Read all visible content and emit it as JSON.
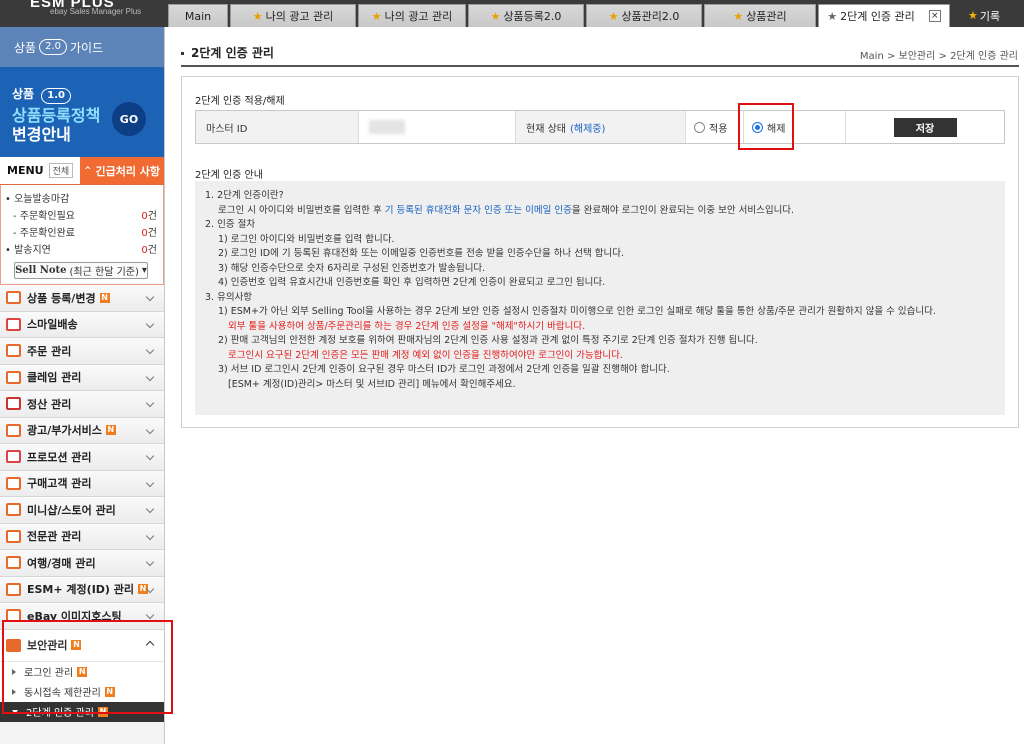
{
  "logo": {
    "text": "ESM PLUS",
    "sub": "ebay Sales Manager Plus"
  },
  "tabs": [
    {
      "label": "Main",
      "starred": false
    },
    {
      "label": "나의 광고 관리",
      "starred": true
    },
    {
      "label": "나의 광고 관리",
      "starred": true
    },
    {
      "label": "상품등록2.0",
      "starred": true
    },
    {
      "label": "상품관리2.0",
      "starred": true
    },
    {
      "label": "상품관리",
      "starred": true
    },
    {
      "label": "2단계 인증 관리",
      "starred": true,
      "active": true
    }
  ],
  "tab_close": "×",
  "history": "기록",
  "sidebar": {
    "guide": {
      "pre": "상품",
      "ver": "2.0",
      "post": "가이드"
    },
    "promo": {
      "pre": "상품",
      "ver": "1.0",
      "line1": "상품등록정책",
      "line2": "변경안내",
      "go": "GO"
    },
    "menu_label": "MENU",
    "menu_all": "전체",
    "emergency": "긴급처리 사항",
    "status": [
      {
        "label": "• 오늘발송마감",
        "count": "",
        "sub": false
      },
      {
        "label": "- 주문확인필요",
        "count": "0",
        "unit": "건",
        "sub": true
      },
      {
        "label": "- 주문확인완료",
        "count": "0",
        "unit": "건",
        "sub": true
      },
      {
        "label": "• 발송지연",
        "count": "0",
        "unit": "건",
        "sub": false
      }
    ],
    "sell_note": {
      "bold": "Sell Note",
      "rest": "(최근 한달 기준)",
      "caret": "▾"
    },
    "menu": [
      {
        "label": "상품 등록/변경",
        "new": true,
        "color": "#e86a2a"
      },
      {
        "label": "스마일배송",
        "new": false,
        "color": "#d44"
      },
      {
        "label": "주문 관리",
        "new": false,
        "color": "#e86a2a"
      },
      {
        "label": "클레임 관리",
        "new": false,
        "color": "#e86a2a"
      },
      {
        "label": "정산 관리",
        "new": false,
        "color": "#c33"
      },
      {
        "label": "광고/부가서비스",
        "new": true,
        "color": "#e86a2a"
      },
      {
        "label": "프로모션 관리",
        "new": false,
        "color": "#d44"
      },
      {
        "label": "구매고객 관리",
        "new": false,
        "color": "#e86a2a"
      },
      {
        "label": "미니샵/스토어 관리",
        "new": false,
        "color": "#e86a2a"
      },
      {
        "label": "전문관 관리",
        "new": false,
        "color": "#e86a2a"
      },
      {
        "label": "여행/경매 관리",
        "new": false,
        "color": "#e86a2a"
      },
      {
        "label": "ESM+ 계정(ID) 관리",
        "new": true,
        "color": "#e86a2a"
      },
      {
        "label": "eBay 이미지호스팅",
        "new": false,
        "color": "#e86a2a"
      }
    ],
    "security": {
      "label": "보안관리",
      "new": true,
      "items": [
        {
          "label": "로그인 관리",
          "new": true,
          "active": false
        },
        {
          "label": "동시접속 제한관리",
          "new": true,
          "active": false
        },
        {
          "label": "2단계 인증 관리",
          "new": true,
          "active": true
        }
      ]
    },
    "badge_n": "N"
  },
  "main": {
    "title": "2단계 인증 관리",
    "breadcrumb": "Main > 보안관리 > 2단계 인증 관리",
    "section1_title": "2단계 인증 적용/해제",
    "master_id_label": "마스터 ID",
    "status_label": "현재 상태",
    "status_value": "(해제중)",
    "radio_apply": "적용",
    "radio_release": "해제",
    "radio_selected": "해제",
    "save": "저장",
    "section2_title": "2단계 인증 안내",
    "info": {
      "h1": "1. 2단계 인증이란?",
      "p1_pre": "로그인 시 아이디와 비밀번호를 입력한 후 ",
      "p1_blue": "기 등록된 휴대전화 문자 인증 또는 이메일 인증",
      "p1_post": "을 완료해야 로그인이 완료되는 이중 보안 서비스입니다.",
      "h2": "2. 인증 절차",
      "steps": [
        "1) 로그인 아이디와 비밀번호를 입력 합니다.",
        "2) 로그인 ID에 기 등록된 휴대전화 또는 이메일중 인증번호를 전송 받을 인증수단을 하나 선택 합니다.",
        "3) 해당 인증수단으로 숫자 6자리로 구성된 인증번호가 발송됩니다.",
        "4) 인증번호 입력 유효시간내 인증번호를 확인 후 입력하면 2단계 인증이 완료되고 로그인 됩니다."
      ],
      "h3": "3. 유의사항",
      "n1": "1) ESM+가 아닌 외부 Selling Tool을 사용하는 경우 2단계 보안 인증 설정시 인증절차 미이행으로 인한 로그인 실패로 해당 툴을 통한 상품/주문 관리가 원활하지 않을 수 있습니다.",
      "n1_red": "외부 툴을 사용하여 상품/주문관리를 하는 경우 2단계 인증 설정을 \"해제\"하시기 바랍니다.",
      "n2": "2) 판매 고객님의 안전한 계정 보호를 위하여 판매자님의 2단계 인증 사용 설정과 관계 없이 특정 주기로 2단계 인증 절차가 진행 됩니다.",
      "n2_red": "로그인시 요구된 2단계 인증은 모든 판매 계정 예외 없이 인증을 진행하여야만 로그인이 가능합니다.",
      "n3": "3) 서브 ID 로그인시 2단계 인증이 요구된 경우 마스터 ID가 로그인 과정에서 2단계 인증을 일괄 진행해야 합니다.",
      "n3b": "[ESM+ 계정(ID)관리> 마스터 및 서브ID 관리] 메뉴에서 확인해주세요."
    }
  },
  "colors": {
    "accent": "#f06a32",
    "brand_blue": "#1c63b6",
    "highlight": "#e01010"
  }
}
